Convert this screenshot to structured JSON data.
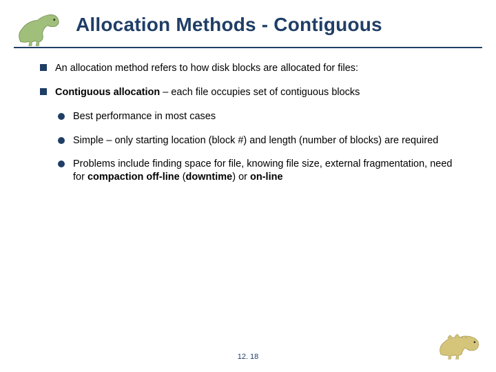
{
  "title": "Allocation Methods - Contiguous",
  "bullets": {
    "b1": "An allocation method refers to how disk blocks are allocated for files:",
    "b2_pre": "Contiguous allocation",
    "b2_post": " – each file occupies set of contiguous blocks",
    "s1": "Best performance in most cases",
    "s2": "Simple – only starting location (block #) and length (number of blocks) are required",
    "s3_a": "Problems include finding space for file, knowing file size, external fragmentation, need for ",
    "s3_b": "compaction off-line",
    "s3_c": " (",
    "s3_d": "downtime",
    "s3_e": ") or ",
    "s3_f": "on-line"
  },
  "page_number": "12. 18"
}
